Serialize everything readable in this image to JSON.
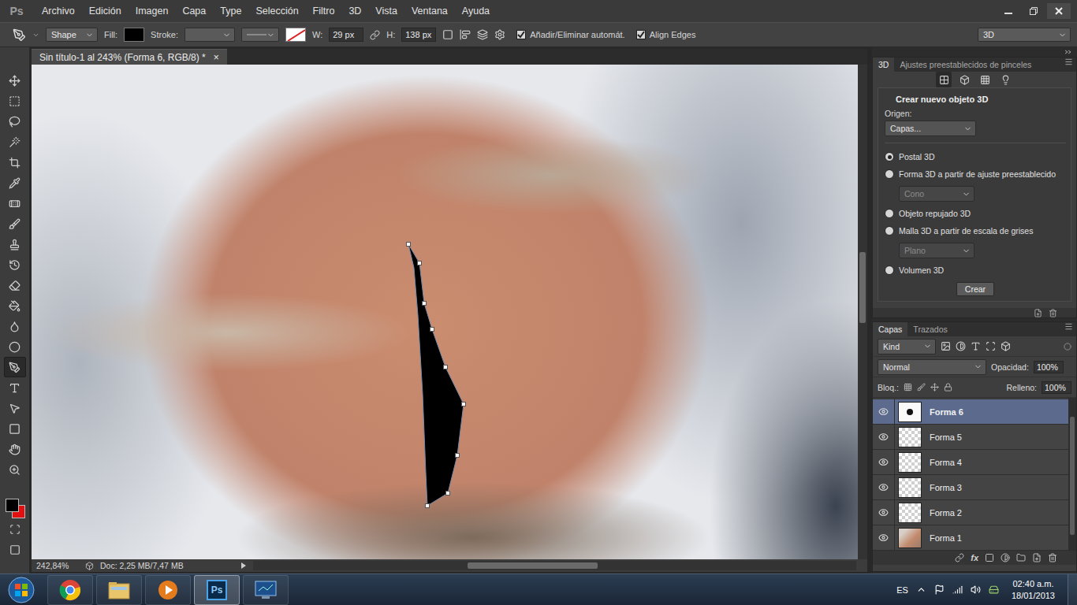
{
  "app": {
    "logo": "Ps"
  },
  "menu": [
    "Archivo",
    "Edición",
    "Imagen",
    "Capa",
    "Type",
    "Selección",
    "Filtro",
    "3D",
    "Vista",
    "Ventana",
    "Ayuda"
  ],
  "options_bar": {
    "mode": "Shape",
    "fill_label": "Fill:",
    "stroke_label": "Stroke:",
    "w_label": "W:",
    "w_value": "29 px",
    "h_label": "H:",
    "h_value": "138 px",
    "checkboxes": [
      {
        "label": "Añadir/Eliminar automát.",
        "checked": true
      },
      {
        "label": "Align Edges",
        "checked": true
      }
    ],
    "workspace": "3D"
  },
  "tools": [
    {
      "selected": false
    },
    {
      "selected": false
    },
    {
      "selected": false
    },
    {
      "selected": false
    },
    {
      "selected": false
    },
    {
      "selected": false
    },
    {
      "selected": false
    },
    {
      "selected": false
    },
    {
      "selected": false
    },
    {
      "selected": false
    },
    {
      "selected": false
    },
    {
      "selected": false
    },
    {
      "selected": false
    },
    {
      "selected": false
    },
    {
      "selected": true
    },
    {
      "selected": false
    },
    {
      "selected": false
    },
    {
      "selected": false
    },
    {
      "selected": false
    },
    {
      "selected": false
    }
  ],
  "document": {
    "tab_title": "Sin título-1 al 243% (Forma 6, RGB/8) *",
    "close": "×"
  },
  "status_bar": {
    "zoom": "242,84%",
    "doc_size": "Doc: 2,25 MB/7,47 MB"
  },
  "panel_3d": {
    "tabs": [
      {
        "label": "3D",
        "selected": true
      },
      {
        "label": "Ajustes preestablecidos de pinceles",
        "selected": false
      }
    ],
    "title": "Crear nuevo objeto 3D",
    "origin_label": "Origen:",
    "origin_value": "Capas...",
    "options": [
      {
        "kind": "radio",
        "label": "Postal 3D",
        "selected": true,
        "disabled": false
      },
      {
        "kind": "radio",
        "label": "Forma 3D a partir de ajuste preestablecido",
        "selected": false,
        "disabled": false
      },
      {
        "kind": "select",
        "label": "Cono",
        "selected": false,
        "disabled": true
      },
      {
        "kind": "radio",
        "label": "Objeto repujado 3D",
        "selected": false,
        "disabled": false
      },
      {
        "kind": "radio",
        "label": "Malla 3D a partir de escala de grises",
        "selected": false,
        "disabled": false
      },
      {
        "kind": "select",
        "label": "Plano",
        "selected": false,
        "disabled": true
      },
      {
        "kind": "radio",
        "label": "Volumen 3D",
        "selected": false,
        "disabled": false
      }
    ],
    "button": "Crear"
  },
  "layers_panel": {
    "tabs": [
      {
        "label": "Capas",
        "selected": true
      },
      {
        "label": "Trazados",
        "selected": false
      }
    ],
    "filter": "Kind",
    "blend_mode": "Normal",
    "opacity_label": "Opacidad:",
    "opacity": "100%",
    "lock_label": "Bloq.:",
    "fill_label": "Relleno:",
    "fill": "100%",
    "layers": [
      {
        "name": "Forma 6",
        "selected": true,
        "visible": true,
        "kind": "vector"
      },
      {
        "name": "Forma 5",
        "selected": false,
        "visible": true,
        "kind": "raster"
      },
      {
        "name": "Forma 4",
        "selected": false,
        "visible": true,
        "kind": "raster"
      },
      {
        "name": "Forma 3",
        "selected": false,
        "visible": true,
        "kind": "raster"
      },
      {
        "name": "Forma 2",
        "selected": false,
        "visible": true,
        "kind": "raster"
      },
      {
        "name": "Forma 1",
        "selected": false,
        "visible": true,
        "kind": "photo"
      }
    ],
    "footer_fx": "fx"
  },
  "taskbar": {
    "apps": [
      {
        "kind": "chrome",
        "active": false,
        "label": ""
      },
      {
        "kind": "explorer",
        "active": false,
        "label": ""
      },
      {
        "kind": "media",
        "active": false,
        "label": ""
      },
      {
        "kind": "photoshop",
        "active": true,
        "label": "Ps"
      },
      {
        "kind": "monitor",
        "active": false,
        "label": ""
      }
    ],
    "language": "ES",
    "time": "02:40 a.m.",
    "date": "18/01/2013"
  }
}
